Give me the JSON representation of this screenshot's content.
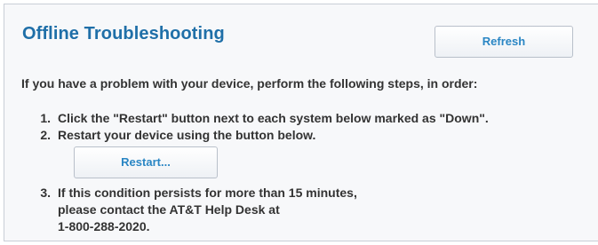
{
  "panel": {
    "title": "Offline Troubleshooting",
    "refresh_label": "Refresh",
    "intro": "If you have a problem with your device, perform the following steps, in order:",
    "steps": [
      {
        "num": "1.",
        "lines": [
          "Click the \"Restart\" button next to each system below marked as \"Down\"."
        ]
      },
      {
        "num": "2.",
        "lines": [
          "Restart your device using the button below."
        ]
      },
      {
        "num": "3.",
        "lines": [
          "If this condition persists for more than 15 minutes,",
          "please contact the AT&T Help Desk at",
          "1-800-288-2020."
        ]
      }
    ],
    "restart_label": "Restart..."
  }
}
